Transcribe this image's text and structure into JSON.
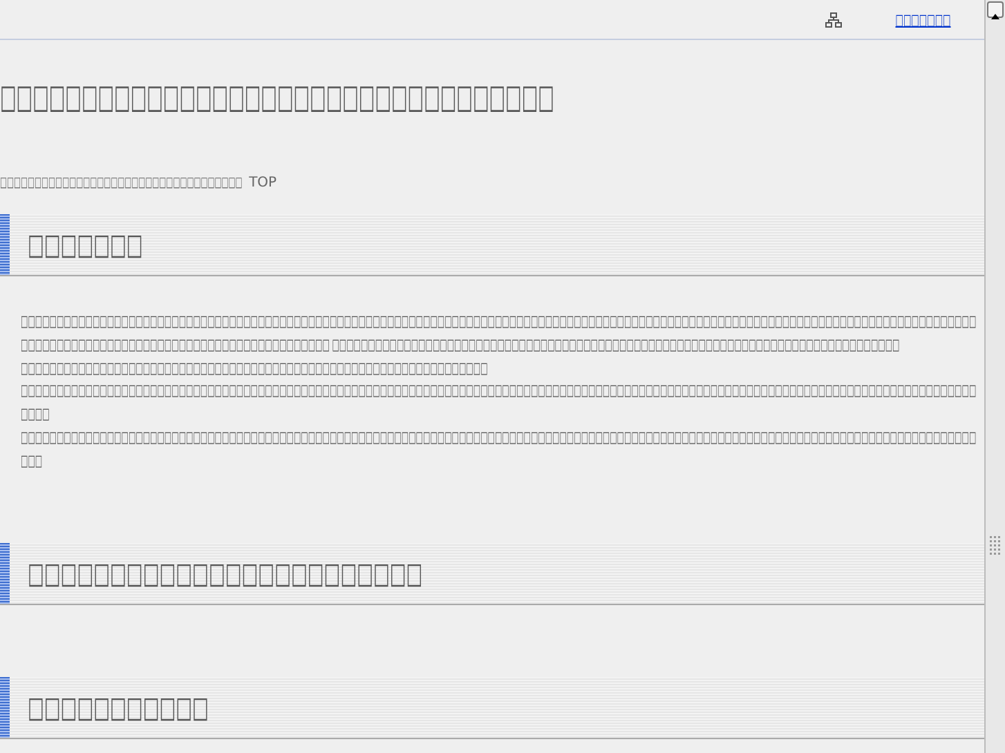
{
  "top_bar": {
    "sitemap_link": "□□□□□□□"
  },
  "page_title": "□□□□□□□□□□□□□□□□□□□□□□□□□□□□□□□□□□",
  "breadcrumb": {
    "text": "□□□□□□□□□□□□□□□□□□□□□□□□□□□□□□□□□□□",
    "link": "TOP"
  },
  "sections": [
    {
      "heading": "□□□□□□□",
      "paragraph": "□□□□□□□□□□□□□□□□□□□□□□□□□□□□□□□□□□□□□□□□□□□□□□□□□□□□□□□□□□□□□□□□□□□□□□□□□□□□□□□□□□□□□□□□□□□□□□□□□□□□□□□□□□□□□□□□□□□□□□□□□□□□□□□□□□□□□□□□□□□□□□□□□□□□□□□□□□□□□□□□□□□□□□□□□□□□□□□□ □□□□□□□□□□□□□□□□□□□□□□□□□□□□□□□□□□□□□□□□□□□□□□□□□□□□□□□□□□□□□□□□□□□□□□□□□□□□□□□ □□□□□□□□□□□□□□□□□□□□□□□□□□□□□□□□□□□□□□□□□□□□□□□□□□□□□□□□□□□□□□□□□ □□□□□□□□□□□□□□□□□□□□□□□□□□□□□□□□□□□□□□□□□□□□□□□□□□□□□□□□□□□□□□□□□□□□□□□□□□□□□□□□□□□□□□□□□□□□□□□□□□□□□□□□□□□□□□□□□□□□□□□□□□□□□□□□□□□□□□□□□ □□□□□□□□□□□□□□□□□□□□□□□□□□□□□□□□□□□□□□□□□□□□□□□□□□□□□□□□□□□□□□□□□□□□□□□□□□□□□□□□□□□□□□□□□□□□□□□□□□□□□□□□□□□□□□□□□□□□□□□□□□□□□□□□□□□□□□□□"
    },
    {
      "heading": "□□□□□□□□□□□□□□□□□□□□□□□□"
    },
    {
      "heading": "□□□□□□□□□□□"
    }
  ]
}
